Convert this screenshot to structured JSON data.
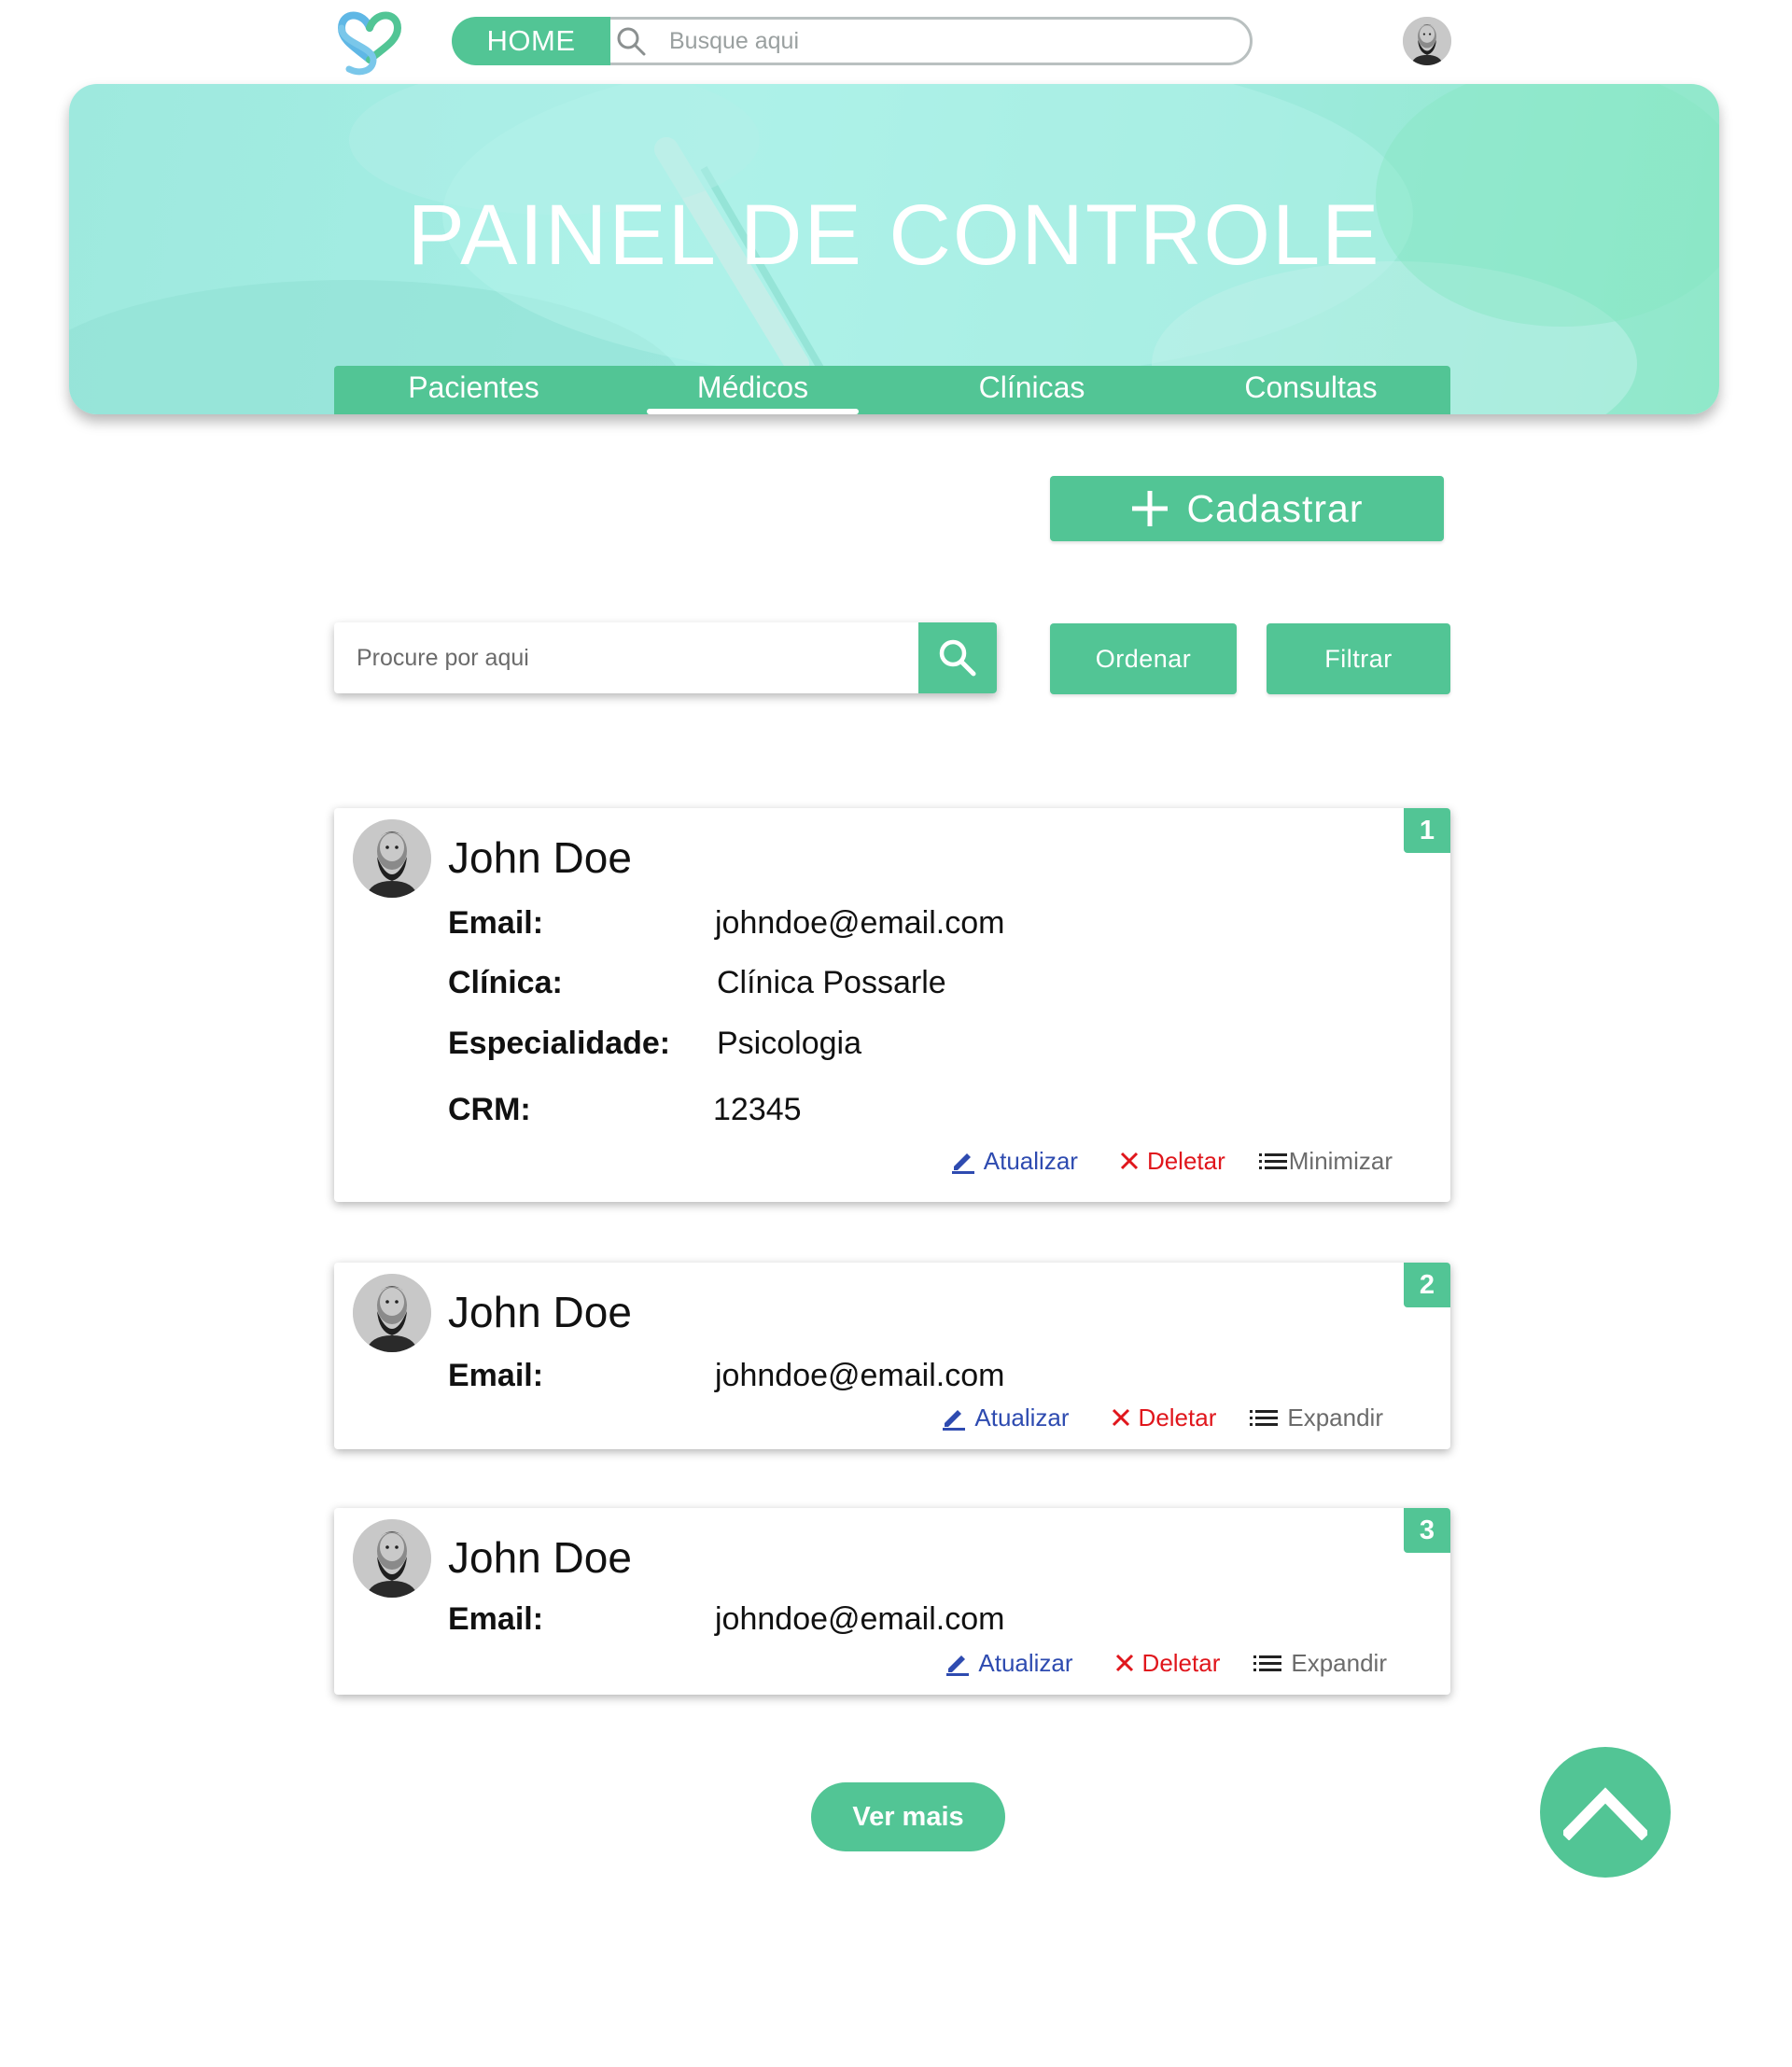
{
  "header": {
    "home_label": "HOME",
    "search_placeholder": "Busque aqui"
  },
  "hero": {
    "title": "PAINEL DE CONTROLE",
    "tabs": [
      {
        "label": "Pacientes",
        "active": false
      },
      {
        "label": "Médicos",
        "active": true
      },
      {
        "label": "Clínicas",
        "active": false
      },
      {
        "label": "Consultas",
        "active": false
      }
    ]
  },
  "toolbar": {
    "register_label": "Cadastrar",
    "search_placeholder": "Procure por aqui",
    "sort_label": "Ordenar",
    "filter_label": "Filtrar"
  },
  "cards": [
    {
      "index": "1",
      "name": "John Doe",
      "email_label": "Email:",
      "email": "johndoe@email.com",
      "clinic_label": "Clínica:",
      "clinic": "Clínica Possarle",
      "specialty_label": "Especialidade:",
      "specialty": "Psicologia",
      "crm_label": "CRM:",
      "crm": "12345",
      "update_label": "Atualizar",
      "delete_label": "Deletar",
      "toggle_label": "Minimizar"
    },
    {
      "index": "2",
      "name": "John Doe",
      "email_label": "Email:",
      "email": "johndoe@email.com",
      "update_label": "Atualizar",
      "delete_label": "Deletar",
      "toggle_label": "Expandir"
    },
    {
      "index": "3",
      "name": "John Doe",
      "email_label": "Email:",
      "email": "johndoe@email.com",
      "update_label": "Atualizar",
      "delete_label": "Deletar",
      "toggle_label": "Expandir"
    }
  ],
  "footer": {
    "see_more_label": "Ver mais"
  },
  "colors": {
    "brand": "#52c595",
    "update": "#2e4bb0",
    "delete": "#e0161c",
    "hero": "#a6efe6"
  },
  "icons": [
    "logo-heart-icon",
    "search-icon",
    "plus-icon",
    "edit-pencil-icon",
    "close-x-icon",
    "list-icon",
    "chevron-up-icon"
  ]
}
